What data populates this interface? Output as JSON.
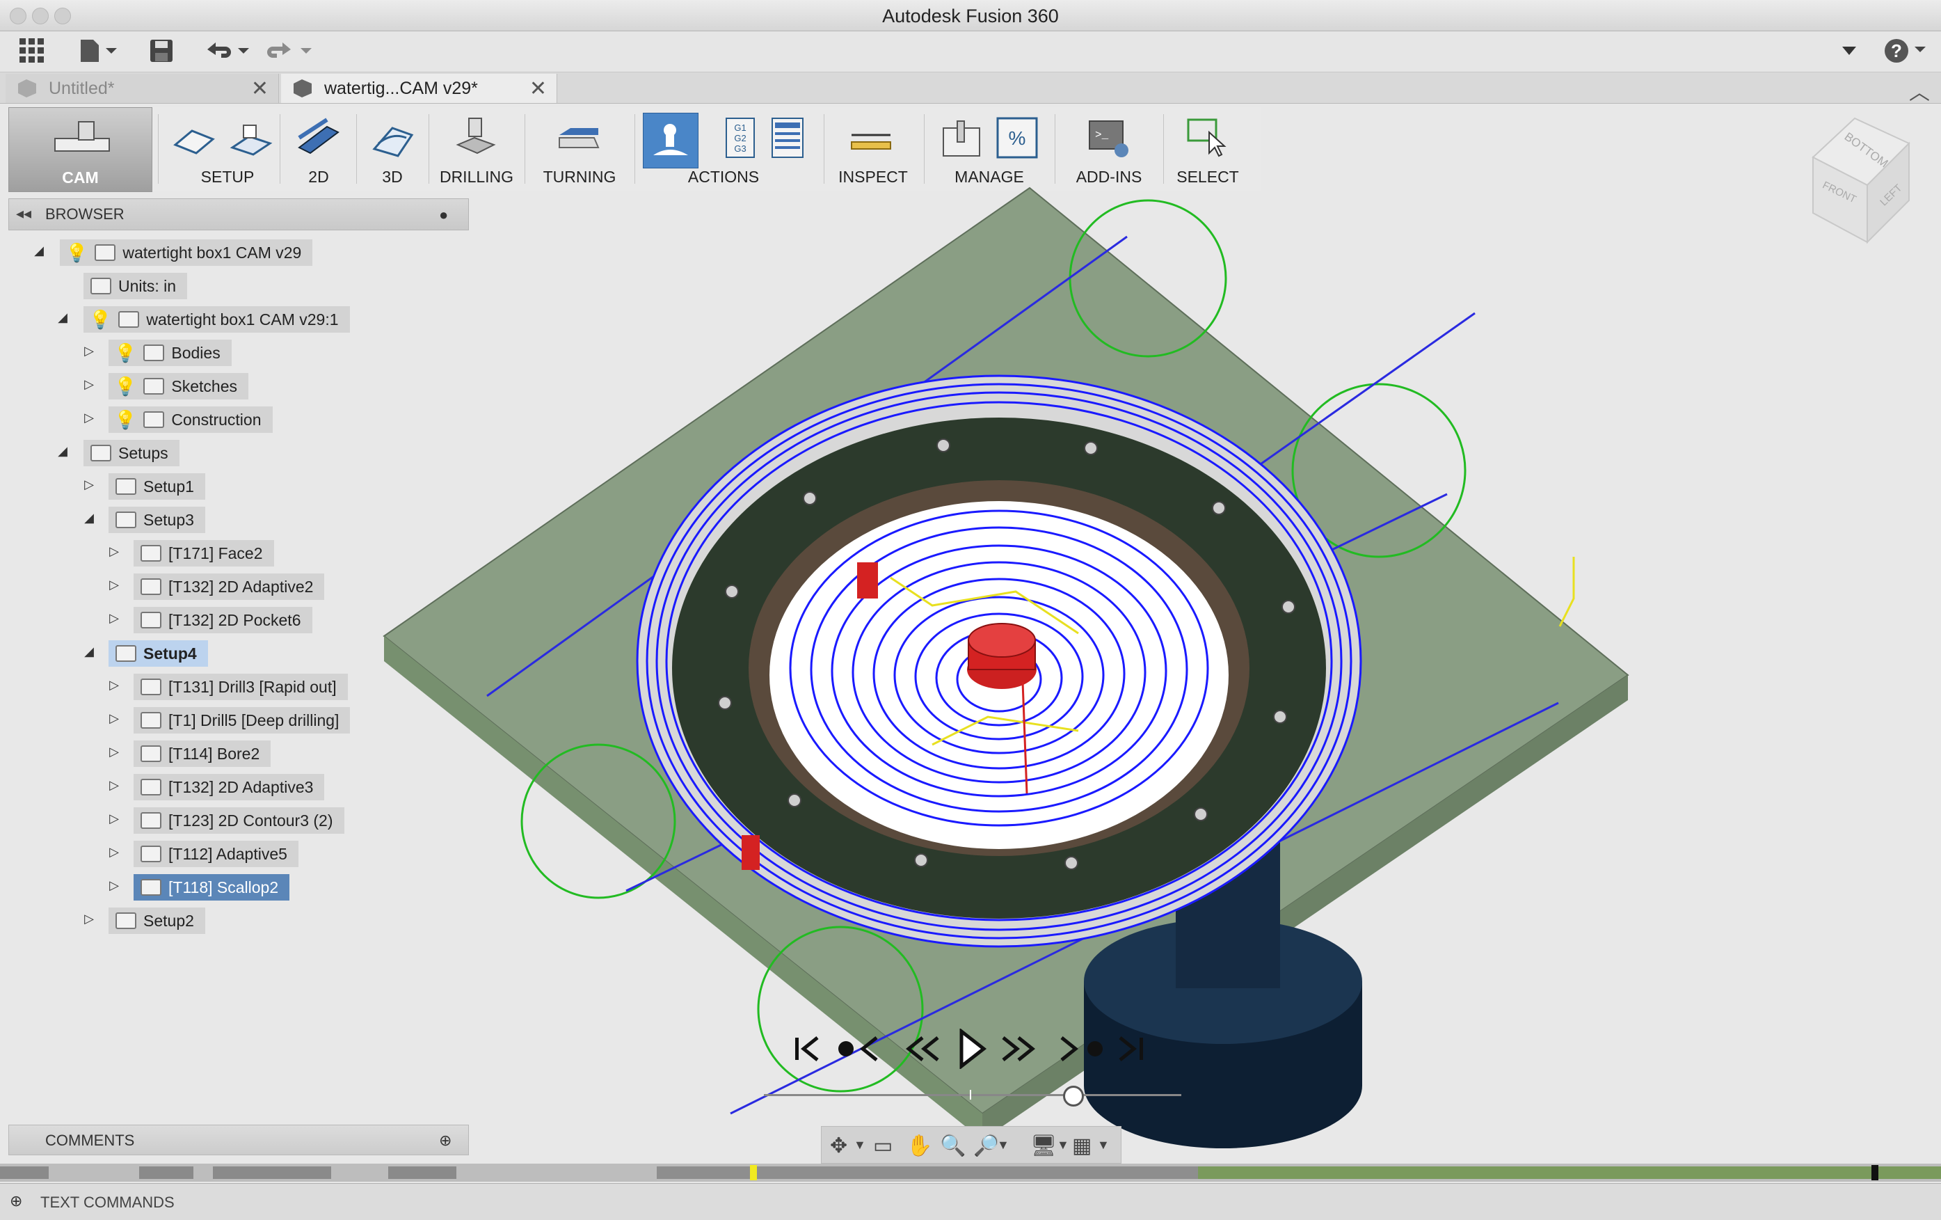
{
  "window": {
    "title": "Autodesk Fusion 360"
  },
  "document_tabs": [
    {
      "label": "Untitled*",
      "active": false
    },
    {
      "label": "watertig...CAM v29*",
      "active": true
    }
  ],
  "ribbon": {
    "workspace": "CAM",
    "groups": [
      "SETUP",
      "2D",
      "3D",
      "DRILLING",
      "TURNING",
      "ACTIONS",
      "INSPECT",
      "MANAGE",
      "ADD-INS",
      "SELECT"
    ]
  },
  "viewcube": {
    "faces": [
      "BOTTOM",
      "FRONT",
      "LEFT"
    ]
  },
  "browser": {
    "title": "BROWSER",
    "root": "watertight box1 CAM v29",
    "units": "Units: in",
    "component": "watertight box1 CAM v29:1",
    "folders": [
      "Bodies",
      "Sketches",
      "Construction"
    ],
    "setups_label": "Setups",
    "setup1": "Setup1",
    "setup3": "Setup3",
    "setup3_ops": [
      "[T171] Face2",
      "[T132] 2D Adaptive2",
      "[T132] 2D Pocket6"
    ],
    "setup4": "Setup4",
    "setup4_ops": [
      "[T131] Drill3 [Rapid out]",
      "[T1] Drill5 [Deep drilling]",
      "[T114] Bore2",
      "[T132] 2D Adaptive3",
      "[T123] 2D Contour3 (2)",
      "[T112] Adaptive5",
      "[T118] Scallop2"
    ],
    "setup2": "Setup2"
  },
  "comments": {
    "title": "COMMENTS"
  },
  "text_commands": {
    "title": "TEXT COMMANDS"
  },
  "colors": {
    "toolpath": "#1a1aff",
    "stock_plate": "#8a9e84",
    "lead_arcs": "#22bb22",
    "selection_blue": "#5b86b8",
    "timeline_green": "#7a9a5c"
  }
}
